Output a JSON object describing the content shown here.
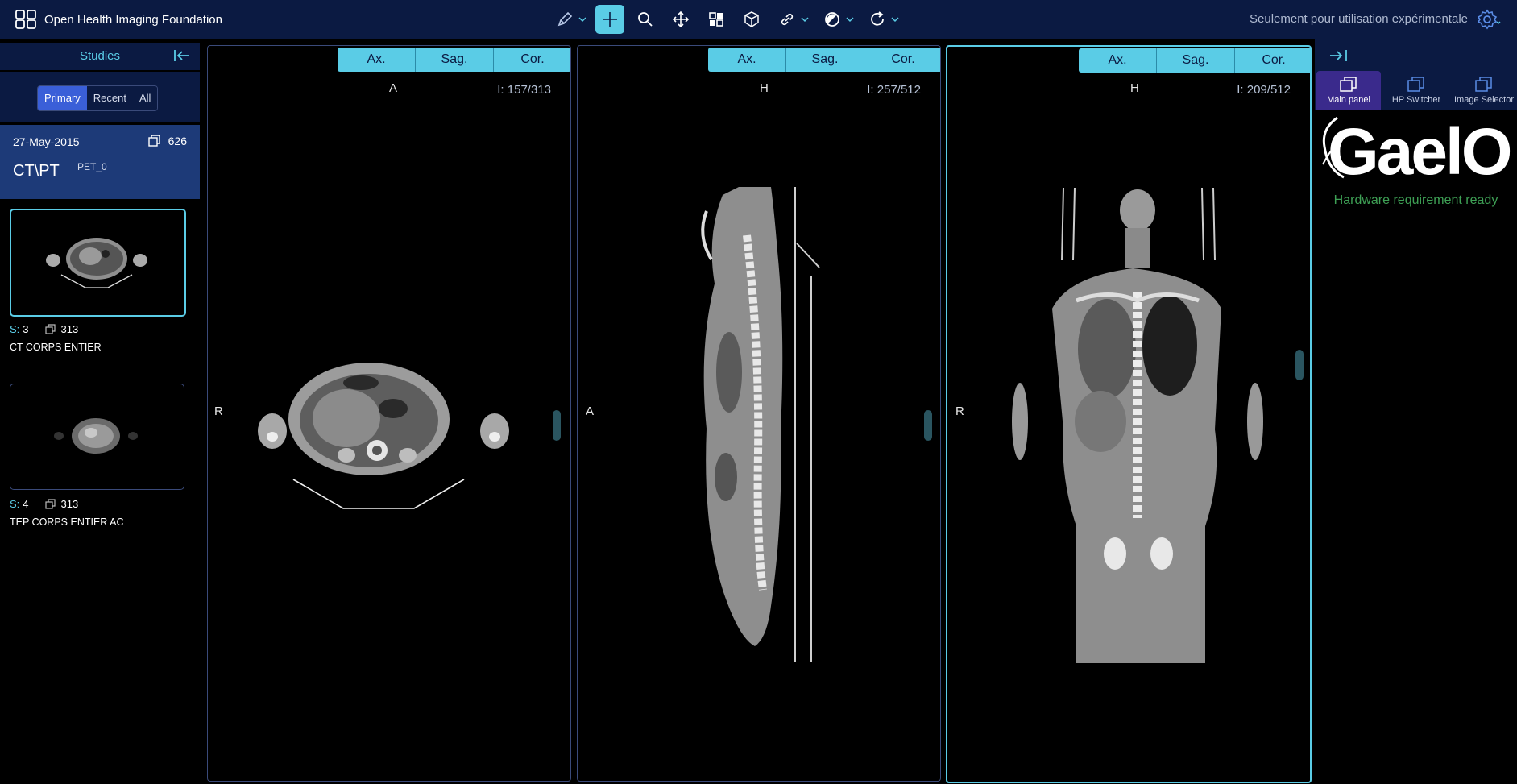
{
  "header": {
    "brand": "Open Health Imaging Foundation",
    "experimental_notice": "Seulement pour utilisation expérimentale",
    "tools": [
      {
        "name": "annotate",
        "icon": "pencil-icon"
      },
      {
        "name": "crosshair",
        "icon": "crosshair-icon",
        "active": true
      },
      {
        "name": "zoom",
        "icon": "magnifier-icon"
      },
      {
        "name": "pan",
        "icon": "move-icon"
      },
      {
        "name": "layout",
        "icon": "layout-icon"
      },
      {
        "name": "3d",
        "icon": "cube-icon"
      },
      {
        "name": "link",
        "icon": "link-icon"
      },
      {
        "name": "window-level",
        "icon": "contrast-icon"
      },
      {
        "name": "rotate",
        "icon": "rotate-icon"
      }
    ]
  },
  "left_panel": {
    "title": "Studies",
    "filters": [
      "Primary",
      "Recent",
      "All"
    ],
    "active_filter": "Primary",
    "study": {
      "date": "27-May-2015",
      "instances": "626",
      "modality": "CT\\PT",
      "description": "PET_0"
    },
    "series": [
      {
        "s_label": "S:",
        "s_num": "3",
        "instances": "313",
        "name": "CT CORPS ENTIER"
      },
      {
        "s_label": "S:",
        "s_num": "4",
        "instances": "313",
        "name": "TEP CORPS ENTIER AC"
      }
    ]
  },
  "viewports": [
    {
      "buttons": [
        "Ax.",
        "Sag.",
        "Cor."
      ],
      "top_marker": "A",
      "left_marker": "R",
      "slice_label": "I:",
      "slice": "157/313"
    },
    {
      "buttons": [
        "Ax.",
        "Sag.",
        "Cor."
      ],
      "top_marker": "H",
      "left_marker": "A",
      "slice_label": "I:",
      "slice": "257/512"
    },
    {
      "buttons": [
        "Ax.",
        "Sag.",
        "Cor."
      ],
      "top_marker": "H",
      "left_marker": "R",
      "slice_label": "I:",
      "slice": "209/512"
    }
  ],
  "right_panel": {
    "tabs": [
      "Main panel",
      "HP Switcher",
      "Image Selector"
    ],
    "active_tab": "Main panel",
    "logo_text": "GaelO",
    "status": "Hardware requirement ready"
  },
  "colors": {
    "navy": "#0b1a42",
    "accent": "#5acce6",
    "study_bg": "#1d3a78",
    "status_green": "#3ea055"
  }
}
